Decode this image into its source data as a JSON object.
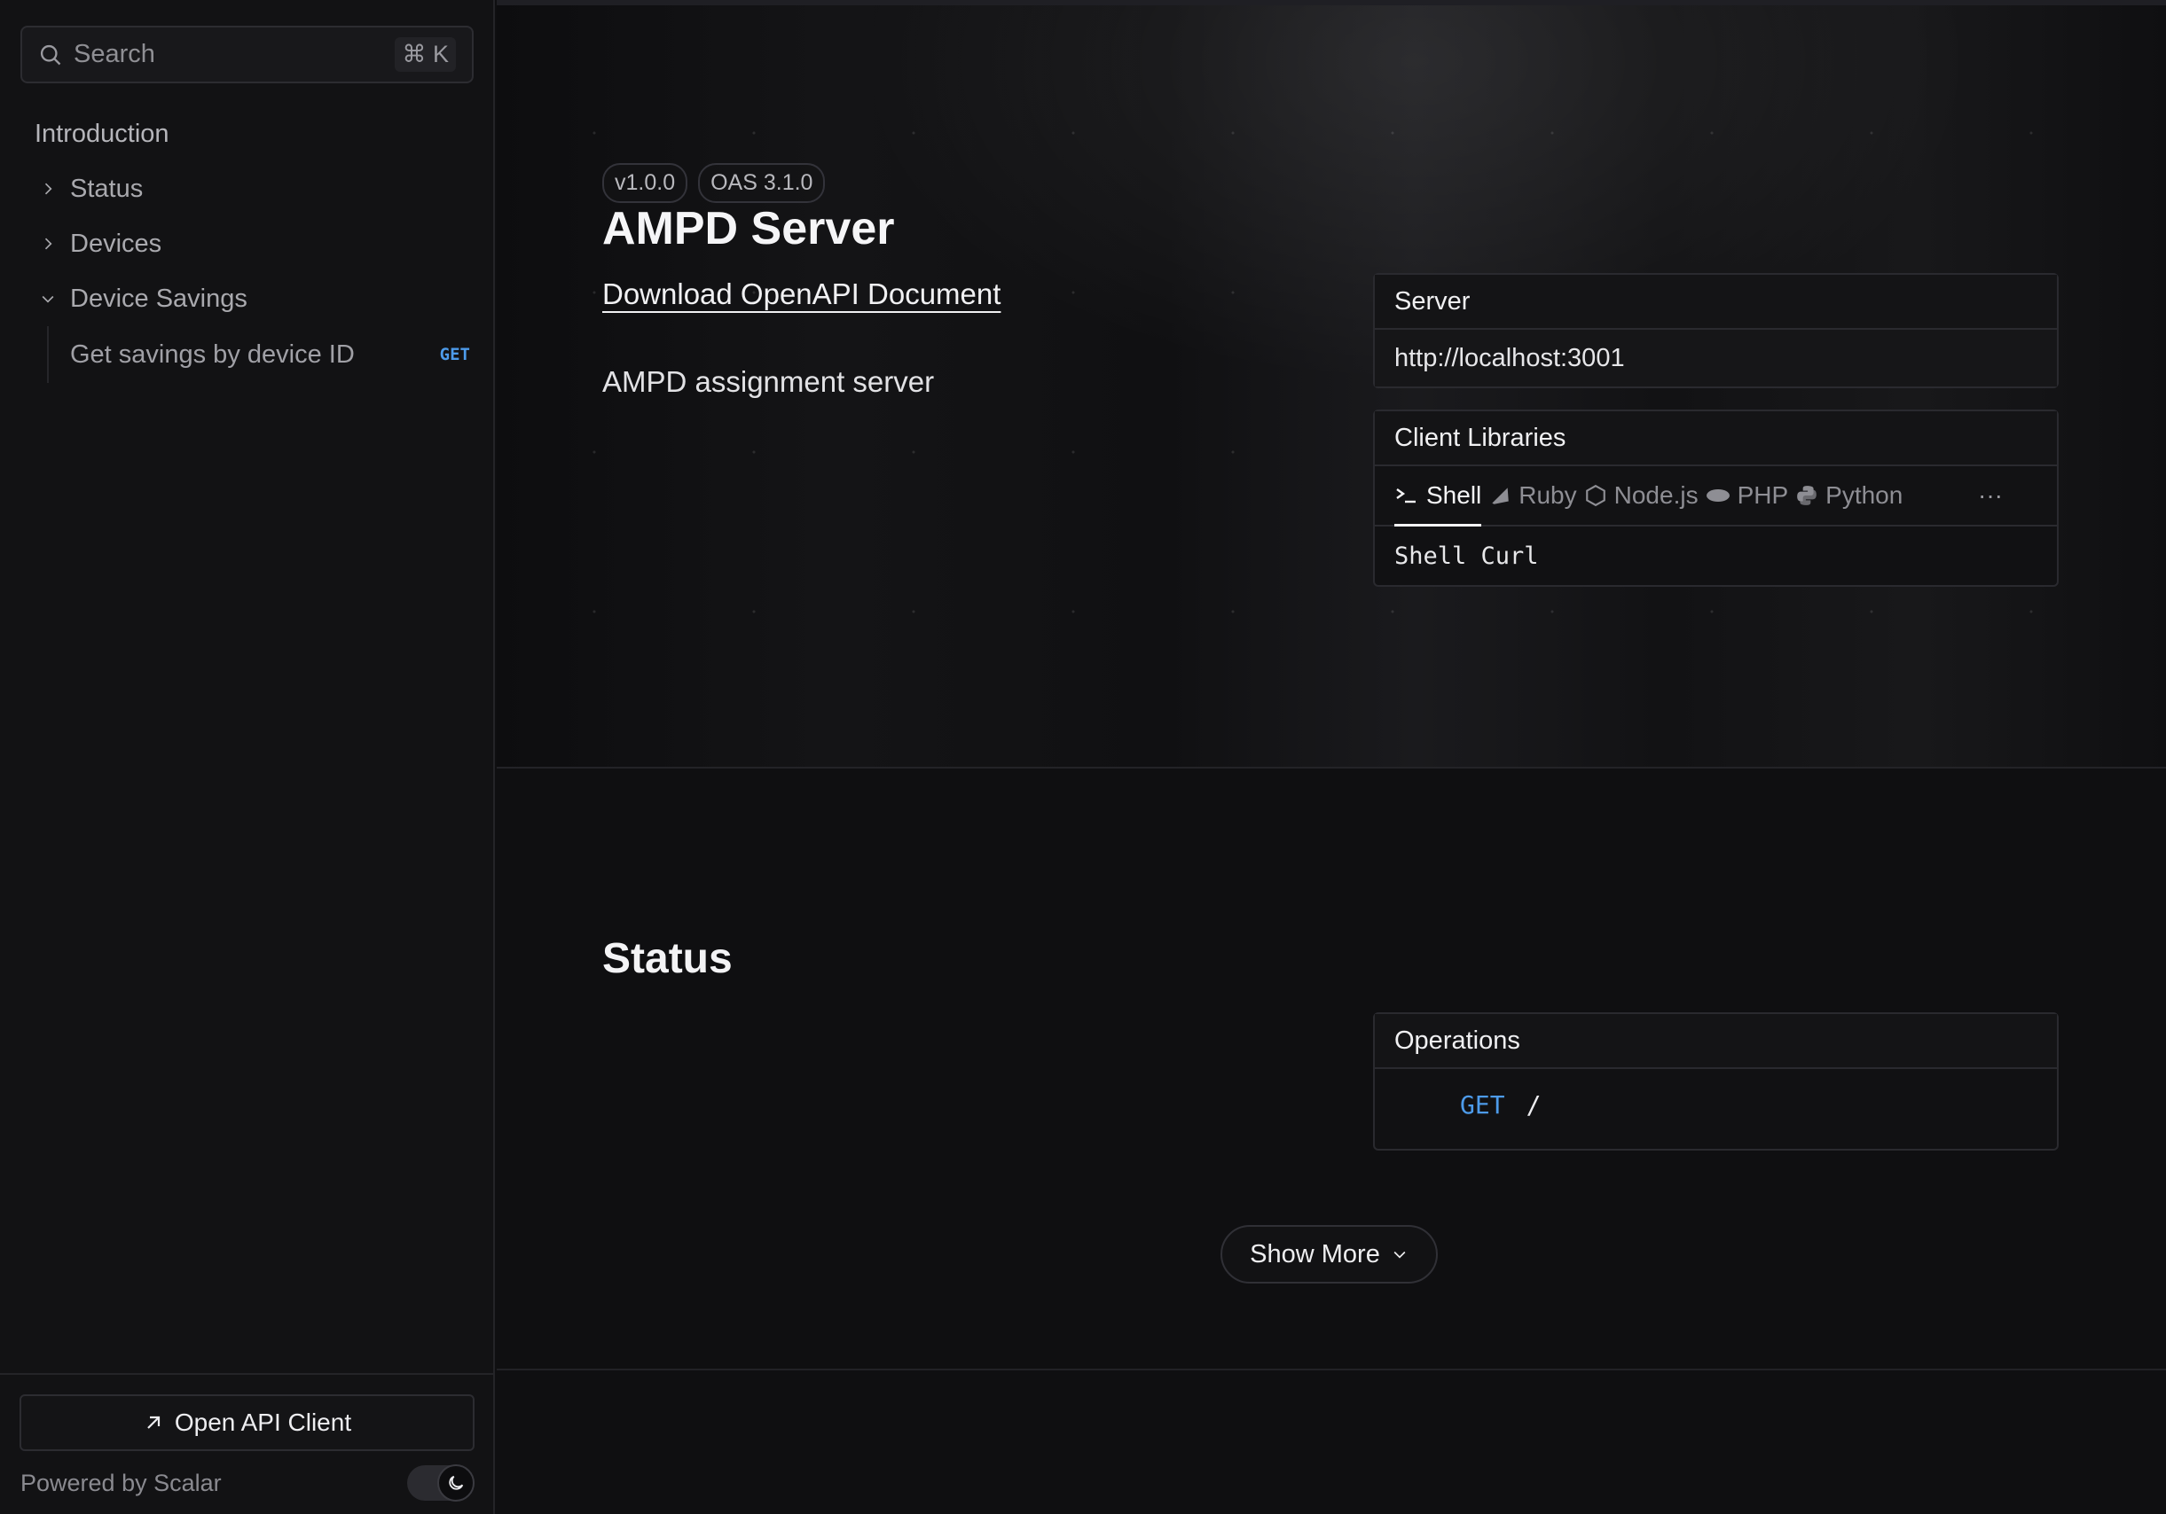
{
  "search": {
    "placeholder": "Search",
    "shortcut": "⌘ K"
  },
  "sidebar": {
    "items": [
      {
        "label": "Introduction"
      },
      {
        "label": "Status"
      },
      {
        "label": "Devices"
      },
      {
        "label": "Device Savings"
      }
    ],
    "sub_items": [
      {
        "label": "Get savings by device ID",
        "method": "GET"
      }
    ],
    "open_client_label": "Open API Client",
    "powered_by": "Powered by Scalar"
  },
  "hero": {
    "version": "v1.0.0",
    "oas": "OAS 3.1.0",
    "title": "AMPD Server",
    "download_label": "Download OpenAPI Document",
    "description": "AMPD assignment server"
  },
  "server": {
    "heading": "Server",
    "url": "http://localhost:3001"
  },
  "client_libraries": {
    "heading": "Client Libraries",
    "tabs": [
      "Shell",
      "Ruby",
      "Node.js",
      "PHP",
      "Python"
    ],
    "more": "···",
    "selected": "Shell Curl"
  },
  "status_section": {
    "title": "Status",
    "operations_heading": "Operations",
    "operations": [
      {
        "method": "GET",
        "path": "/"
      }
    ],
    "show_more": "Show More"
  },
  "colors": {
    "accent_get": "#4d9bea",
    "background": "#0f0f11"
  }
}
